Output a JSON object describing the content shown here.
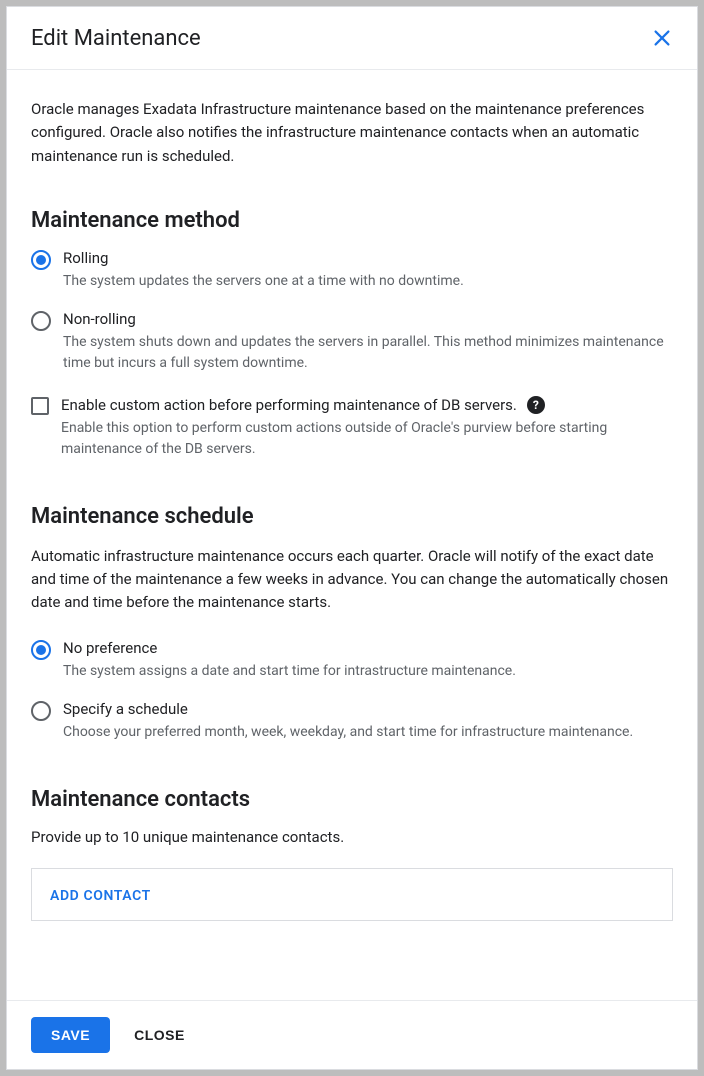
{
  "header": {
    "title": "Edit Maintenance"
  },
  "intro": "Oracle manages Exadata Infrastructure maintenance based on the maintenance preferences configured. Oracle also notifies the infrastructure maintenance contacts when an automatic maintenance run is scheduled.",
  "method": {
    "heading": "Maintenance method",
    "rolling": {
      "label": "Rolling",
      "desc": "The system updates the servers one at a time with no downtime."
    },
    "nonrolling": {
      "label": "Non-rolling",
      "desc": "The system shuts down and updates the servers in parallel. This method minimizes maintenance time but incurs a full system downtime."
    },
    "custom_action": {
      "label": "Enable custom action before performing maintenance of DB servers.",
      "desc": "Enable this option to perform custom actions outside of Oracle's purview before starting maintenance of the DB servers."
    }
  },
  "schedule": {
    "heading": "Maintenance schedule",
    "intro": "Automatic infrastructure maintenance occurs each quarter. Oracle will notify of the exact date and time of the maintenance a few weeks in advance. You can change the automatically chosen date and time before the maintenance starts.",
    "nopref": {
      "label": "No preference",
      "desc": "The system assigns a date and start time for intrastructure maintenance."
    },
    "specify": {
      "label": "Specify a schedule",
      "desc": "Choose your preferred month, week, weekday, and start time for infrastructure maintenance."
    }
  },
  "contacts": {
    "heading": "Maintenance contacts",
    "hint": "Provide up to 10 unique maintenance contacts.",
    "add_label": "ADD CONTACT"
  },
  "footer": {
    "save": "SAVE",
    "close": "CLOSE"
  }
}
